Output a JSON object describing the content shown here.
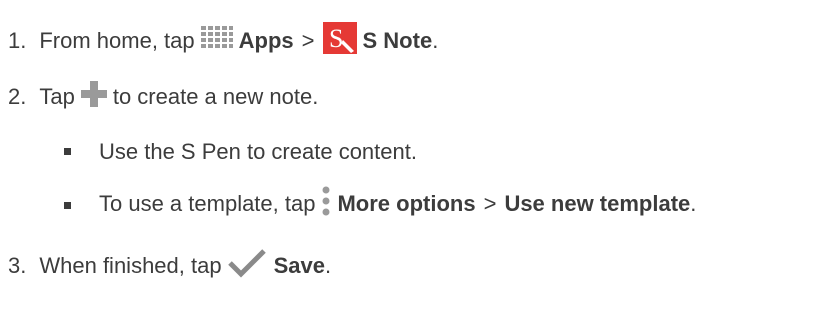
{
  "steps": [
    {
      "number": "1.",
      "text_before": "From home, tap",
      "icon_a": "apps-grid-icon",
      "label_a": "Apps",
      "sep": ">",
      "icon_b": "s-note-icon",
      "label_b": "S Note",
      "end": "."
    },
    {
      "number": "2.",
      "text_before": "Tap",
      "icon_a": "plus-icon",
      "text_after": "to create a new note."
    },
    {
      "number": "3.",
      "text_before": "When finished, tap",
      "icon_a": "checkmark-icon",
      "label_a": "Save",
      "end": "."
    }
  ],
  "bullets": [
    {
      "text": "Use the S Pen to create content."
    },
    {
      "text_before": "To use a template, tap",
      "icon": "more-options-icon",
      "label_a": "More options",
      "sep": ">",
      "label_b": "Use new template",
      "end": "."
    }
  ],
  "colors": {
    "text": "#3c3c3c",
    "icon_gray": "#9a9a9a",
    "s_note_red": "#e53935"
  }
}
